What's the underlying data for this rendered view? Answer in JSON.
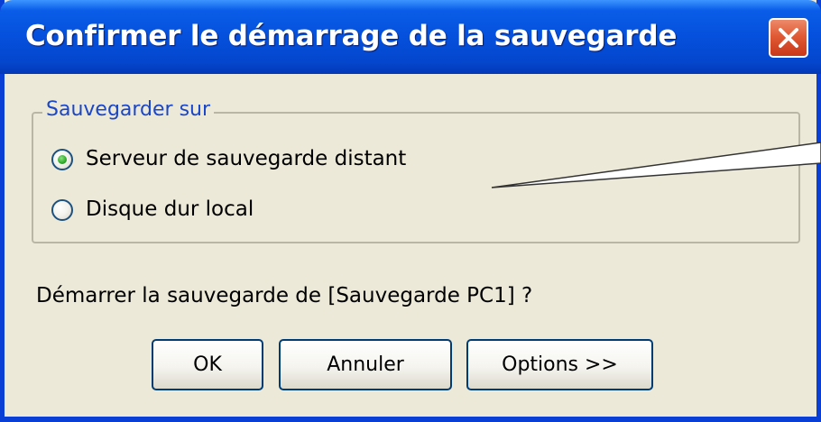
{
  "window": {
    "title": "Confirmer le démarrage de la sauvegarde",
    "close_icon": "close-x-icon"
  },
  "group": {
    "label": "Sauvegarder sur",
    "options": [
      {
        "label": "Serveur de sauvegarde distant",
        "selected": true
      },
      {
        "label": "Disque dur local",
        "selected": false
      }
    ]
  },
  "question": "Démarrer la sauvegarde de [Sauvegarde PC1] ?",
  "buttons": {
    "ok": "OK",
    "cancel": "Annuler",
    "options": "Options >>"
  },
  "colors": {
    "title_bar": "#0550dc",
    "dialog_bg": "#ece9d8",
    "group_label": "#1a46c8",
    "close_button": "#e05a35",
    "radio_selected": "#2fa82a"
  }
}
